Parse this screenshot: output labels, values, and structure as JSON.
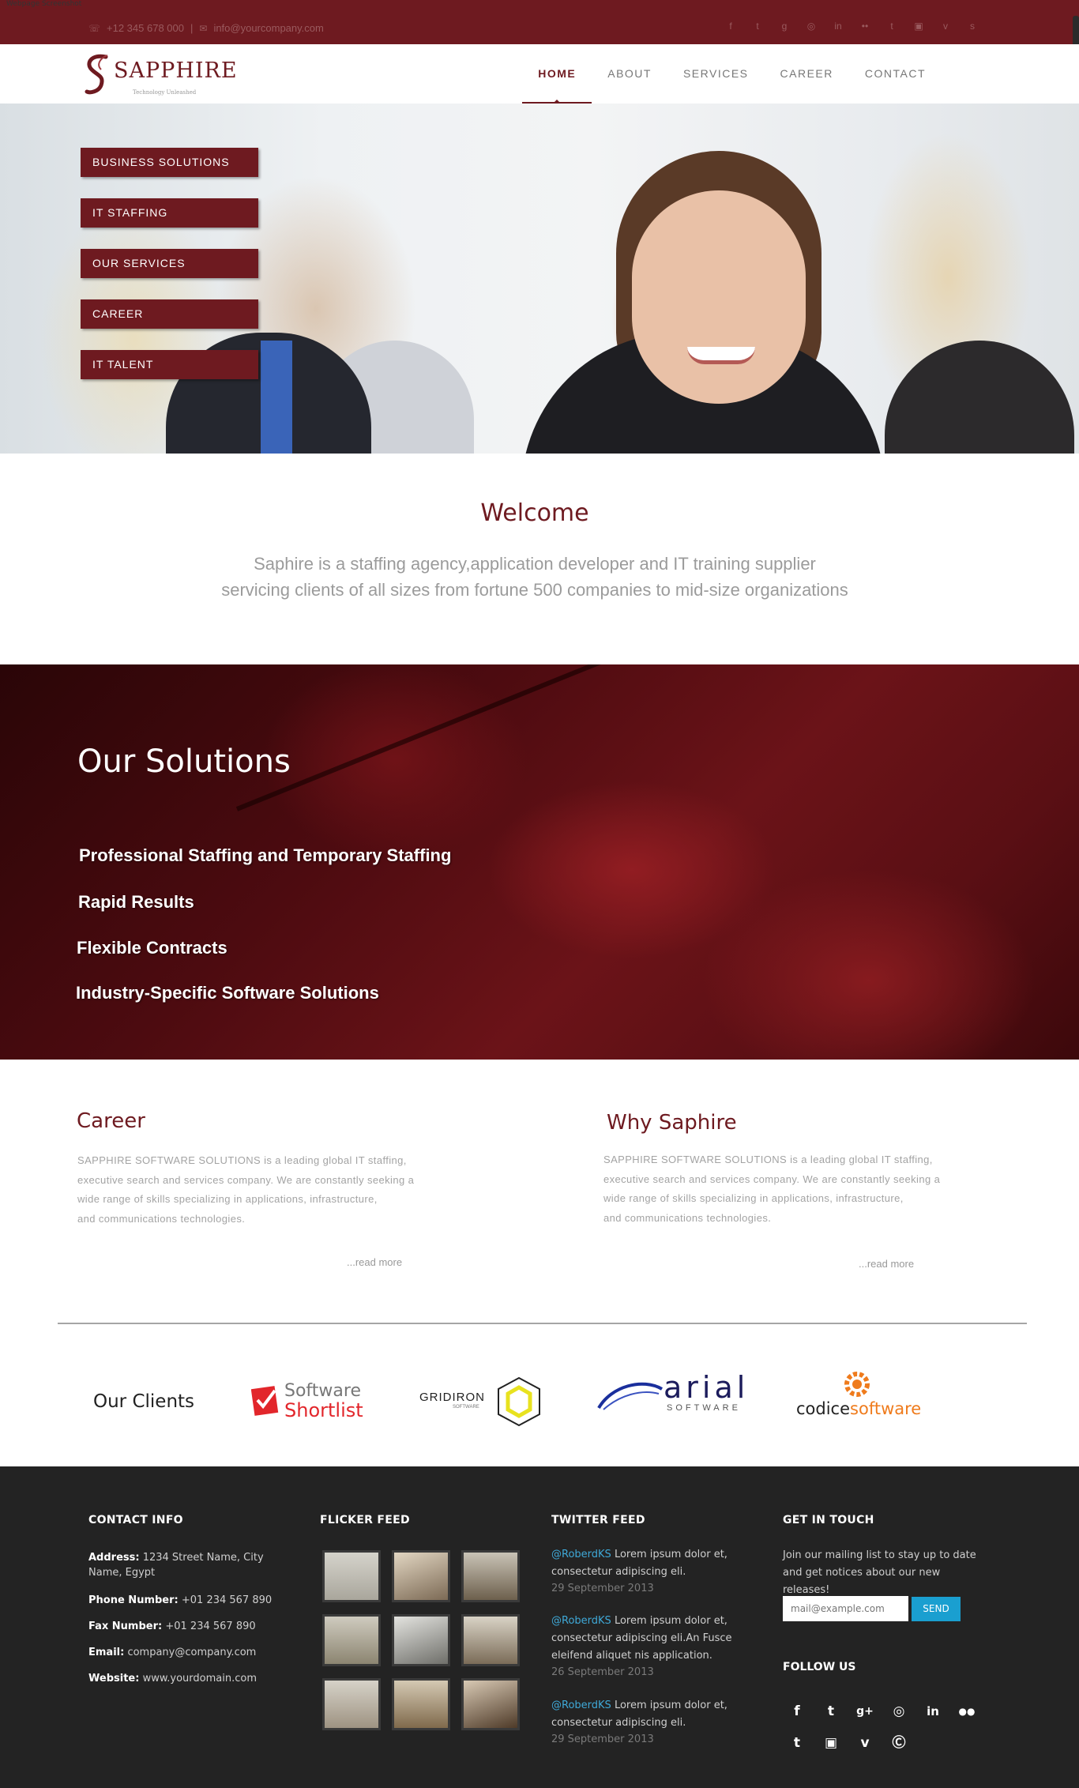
{
  "caption": "Webpage Screenshot",
  "topbar": {
    "phone": "+12 345 678 000",
    "email": "info@yourcompany.com",
    "social_icons": [
      "facebook-icon",
      "twitter-icon",
      "google-plus-icon",
      "dribbble-icon",
      "linkedin-icon",
      "flickr-icon",
      "tumblr-icon",
      "instagram-icon",
      "vimeo-icon",
      "skype-icon"
    ]
  },
  "brand": {
    "name": "SAPPHIRE",
    "tagline": "Technology Unleashed"
  },
  "nav": {
    "items": [
      {
        "label": "HOME",
        "active": true
      },
      {
        "label": "ABOUT",
        "active": false
      },
      {
        "label": "SERVICES",
        "active": false
      },
      {
        "label": "CAREER",
        "active": false
      },
      {
        "label": "CONTACT",
        "active": false
      }
    ]
  },
  "hero": {
    "buttons": [
      "BUSINESS SOLUTIONS",
      "IT STAFFING",
      "OUR SERVICES",
      "CAREER",
      "IT TALENT"
    ]
  },
  "welcome": {
    "title": "Welcome",
    "line1": "Saphire is a staffing agency,application developer and IT training supplier",
    "line2": "servicing clients of all sizes from fortune 500 companies to mid-size organizations"
  },
  "solutions": {
    "title": "Our Solutions",
    "items": [
      "Professional Staffing and Temporary Staffing",
      "Rapid Results",
      "Flexible Contracts",
      "Industry-Specific Software Solutions"
    ]
  },
  "career": {
    "title": "Career",
    "lines": [
      "SAPPHIRE SOFTWARE SOLUTIONS is a leading global IT staffing,",
      "executive search and services company. We are constantly seeking a",
      "wide range of skills specializing in applications, infrastructure,",
      "and communications technologies."
    ],
    "read_more": "...read more"
  },
  "why": {
    "title": "Why Saphire",
    "lines": [
      "SAPPHIRE SOFTWARE SOLUTIONS is a leading global IT staffing,",
      "executive search and services company. We are constantly seeking a",
      "wide range of skills specializing in applications, infrastructure,",
      "and communications technologies."
    ],
    "read_more": "...read more"
  },
  "clients": {
    "label": "Our Clients",
    "software_shortlist": {
      "line1": "Software",
      "line2": "Shortlist"
    },
    "gridiron": {
      "name": "GRIDIRON",
      "sub": "SOFTWARE"
    },
    "arial": {
      "name": "arial",
      "sub": "SOFTWARE"
    },
    "codice": {
      "part1": "codice",
      "part2": "software"
    }
  },
  "footer": {
    "contact": {
      "title": "CONTACT INFO",
      "address_label": "Address:",
      "address": "1234 Street Name, City Name, Egypt",
      "phone_label": "Phone Number:",
      "phone": "+01 234 567 890",
      "fax_label": "Fax Number:",
      "fax": "+01 234 567 890",
      "email_label": "Email:",
      "email": "company@company.com",
      "website_label": "Website:",
      "website": "www.yourdomain.com"
    },
    "flicker": {
      "title": "FLICKER FEED"
    },
    "twitter": {
      "title": "TWITTER FEED",
      "tweets": [
        {
          "handle": "@RoberdKS",
          "text": "Lorem ipsum dolor et, consectetur adipiscing eli.",
          "date": "29 September 2013"
        },
        {
          "handle": "@RoberdKS",
          "text": "Lorem ipsum dolor et, consectetur adipiscing eli.An Fusce eleifend aliquet nis application.",
          "date": "26 September 2013"
        },
        {
          "handle": "@RoberdKS",
          "text": "Lorem ipsum dolor et, consectetur adipiscing eli.",
          "date": "29 September 2013"
        }
      ]
    },
    "touch": {
      "title": "GET IN TOUCH",
      "text": "Join our mailing list to stay up to date and get notices about our new releases!",
      "placeholder": "mail@example.com",
      "send": "SEND",
      "follow": "FOLLOW US"
    }
  },
  "colors": {
    "brand": "#6e1a20",
    "footer_bg": "#232323",
    "accent_blue": "#1a9fd0",
    "link_blue": "#3fa9d8"
  }
}
